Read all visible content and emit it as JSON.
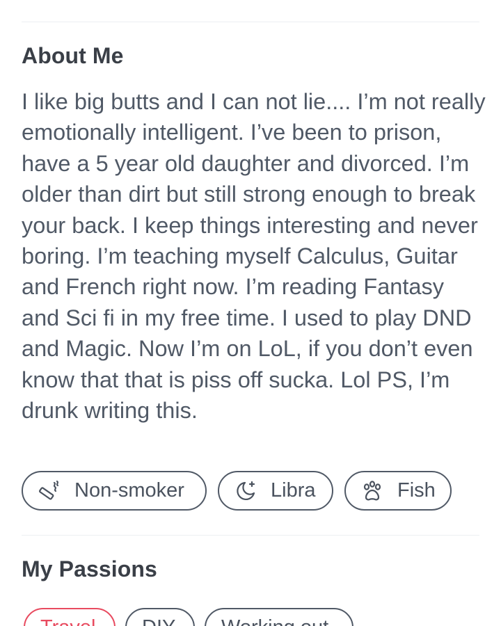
{
  "about": {
    "title": "About Me",
    "bio": "I like big butts and I can not lie.... I’m not really emotionally intelligent. I’ve been to prison, have a 5 year old daughter and divorced. I’m older than dirt but still strong enough to break your back. I keep things interesting and never boring. I’m teaching myself Calculus, Guitar and French right now. I’m reading Fantasy and Sci fi in my free time. I used to play DND and Magic. Now I’m on LoL, if you don’t even know that that is piss off sucka. Lol PS, I’m drunk writing this."
  },
  "badges": [
    {
      "label": "Non-smoker",
      "icon": "no-smoking-icon"
    },
    {
      "label": "Libra",
      "icon": "moon-sparkle-icon"
    },
    {
      "label": "Fish",
      "icon": "paw-icon"
    }
  ],
  "passions": {
    "title": "My Passions",
    "items": [
      {
        "label": "Travel",
        "active": true
      },
      {
        "label": "DIY",
        "active": false
      },
      {
        "label": "Working out",
        "active": false
      }
    ]
  },
  "colors": {
    "text": "#505966",
    "accent": "#e84a5f",
    "divider": "#eceff2"
  }
}
